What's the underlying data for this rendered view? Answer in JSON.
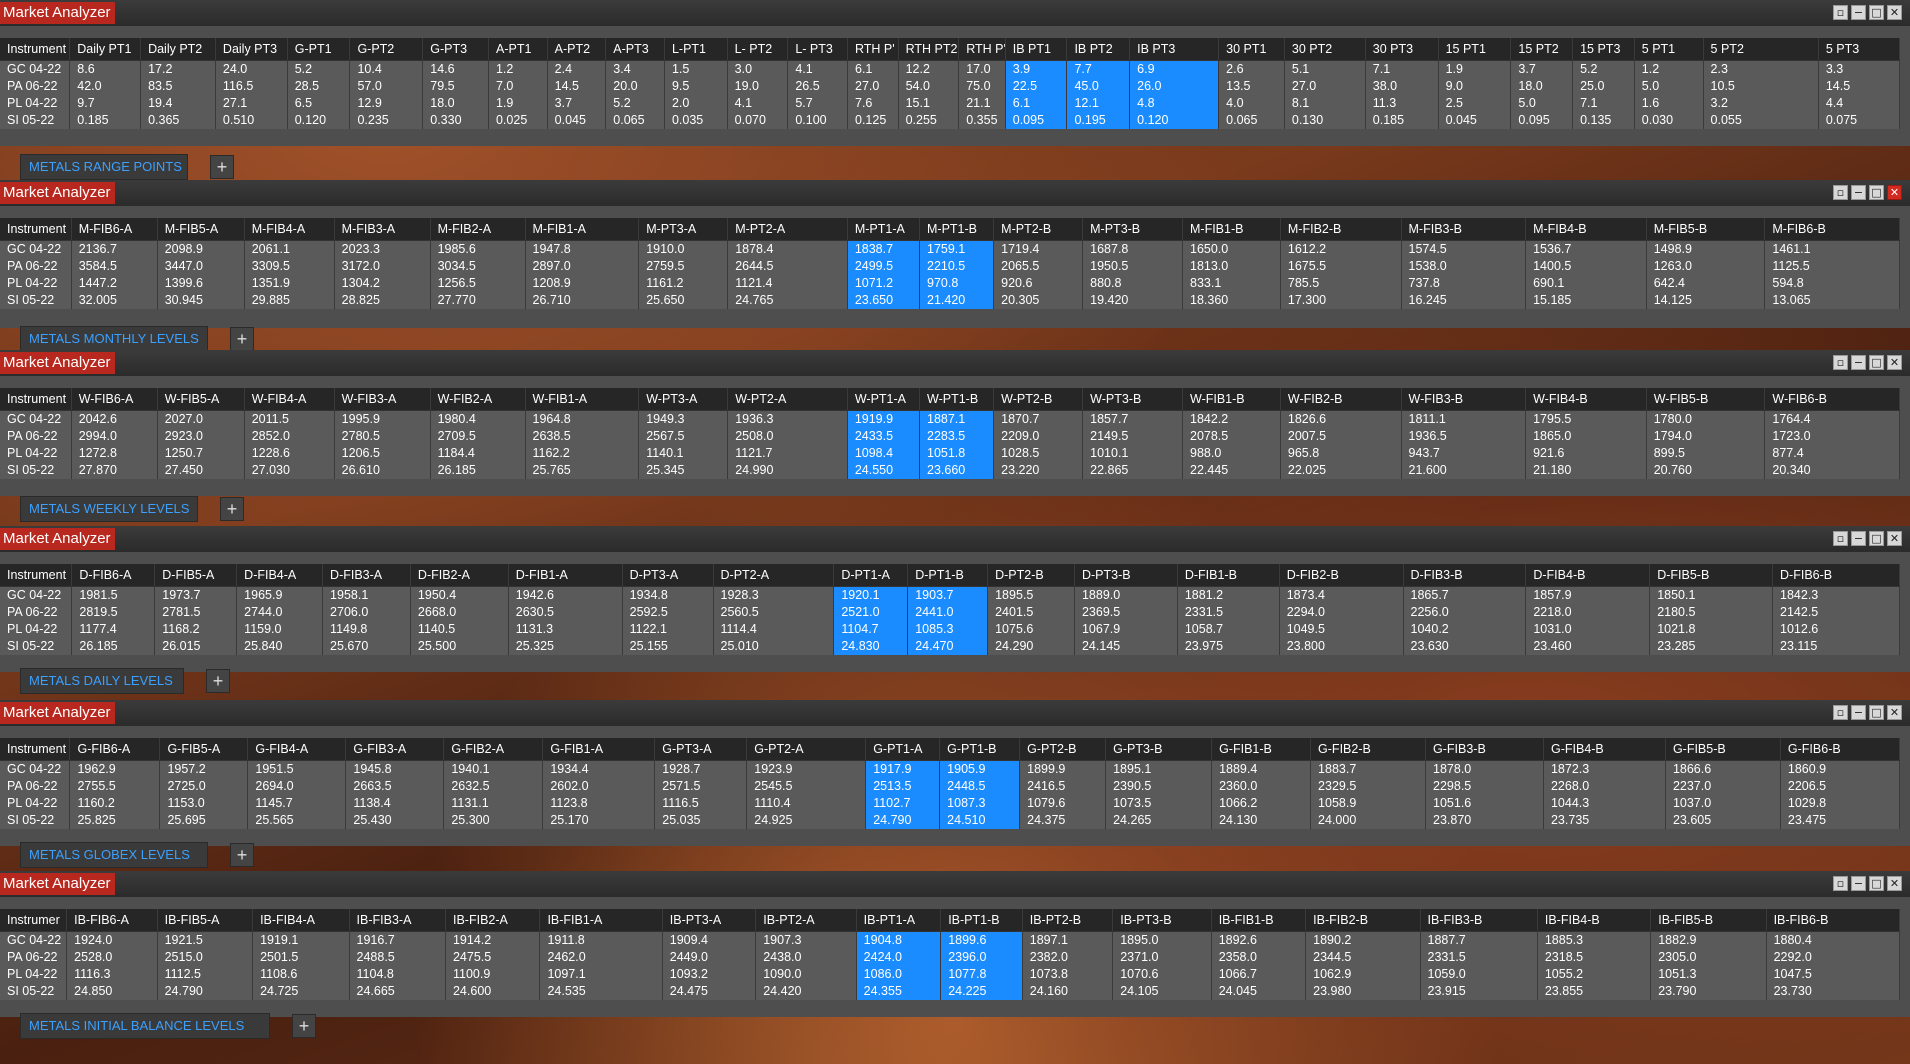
{
  "panels": [
    {
      "title": "Market Analyzer",
      "tab": "METALS RANGE POINTS",
      "close_red": false,
      "columns": [
        "Instrument",
        "Daily PT1",
        "Daily PT2",
        "Daily PT3",
        "G-PT1",
        "G-PT2",
        "G-PT3",
        "A-PT1",
        "A-PT2",
        "A-PT3",
        "L-PT1",
        "L- PT2",
        "L- PT3",
        "RTH P'",
        "RTH PT2",
        "RTH P'",
        "IB PT1",
        "IB PT2",
        "IB PT3",
        "30 PT1",
        "30 PT2",
        "30 PT3",
        "15 PT1",
        "15 PT2",
        "15 PT3",
        "5 PT1",
        "5 PT2",
        "5 PT3"
      ],
      "widths": [
        69,
        70,
        74,
        71,
        62,
        72,
        65,
        58,
        58,
        58,
        62,
        60,
        59,
        50,
        60,
        46,
        61,
        62,
        88,
        65,
        80,
        72,
        72,
        61,
        61,
        68,
        114,
        80
      ],
      "highlight": [
        16,
        17,
        18
      ],
      "rows": [
        [
          "GC 04-22",
          "8.6",
          "17.2",
          "24.0",
          "5.2",
          "10.4",
          "14.6",
          "1.2",
          "2.4",
          "3.4",
          "1.5",
          "3.0",
          "4.1",
          "6.1",
          "12.2",
          "17.0",
          "3.9",
          "7.7",
          "6.9",
          "2.6",
          "5.1",
          "7.1",
          "1.9",
          "3.7",
          "5.2",
          "1.2",
          "2.3",
          "3.3"
        ],
        [
          "PA 06-22",
          "42.0",
          "83.5",
          "116.5",
          "28.5",
          "57.0",
          "79.5",
          "7.0",
          "14.5",
          "20.0",
          "9.5",
          "19.0",
          "26.5",
          "27.0",
          "54.0",
          "75.0",
          "22.5",
          "45.0",
          "26.0",
          "13.5",
          "27.0",
          "38.0",
          "9.0",
          "18.0",
          "25.0",
          "5.0",
          "10.5",
          "14.5"
        ],
        [
          "PL 04-22",
          "9.7",
          "19.4",
          "27.1",
          "6.5",
          "12.9",
          "18.0",
          "1.9",
          "3.7",
          "5.2",
          "2.0",
          "4.1",
          "5.7",
          "7.6",
          "15.1",
          "21.1",
          "6.1",
          "12.1",
          "4.8",
          "4.0",
          "8.1",
          "11.3",
          "2.5",
          "5.0",
          "7.1",
          "1.6",
          "3.2",
          "4.4"
        ],
        [
          "SI 05-22",
          "0.185",
          "0.365",
          "0.510",
          "0.120",
          "0.235",
          "0.330",
          "0.025",
          "0.045",
          "0.065",
          "0.035",
          "0.070",
          "0.100",
          "0.125",
          "0.255",
          "0.355",
          "0.095",
          "0.195",
          "0.120",
          "0.065",
          "0.130",
          "0.185",
          "0.045",
          "0.095",
          "0.135",
          "0.030",
          "0.055",
          "0.075"
        ]
      ]
    },
    {
      "title": "Market Analyzer",
      "tab": "METALS MONTHLY LEVELS",
      "close_red": true,
      "columns": [
        "Instrument",
        "M-FIB6-A",
        "M-FIB5-A",
        "M-FIB4-A",
        "M-FIB3-A",
        "M-FIB2-A",
        "M-FIB1-A",
        "M-PT3-A",
        "M-PT2-A",
        "M-PT1-A",
        "M-PT1-B",
        "M-PT2-B",
        "M-PT3-B",
        "M-FIB1-B",
        "M-FIB2-B",
        "M-FIB3-B",
        "M-FIB4-B",
        "M-FIB5-B",
        "M-FIB6-B"
      ],
      "widths": [
        72,
        87,
        88,
        91,
        97,
        96,
        115,
        90,
        121,
        73,
        75,
        90,
        101,
        99,
        122,
        126,
        122,
        120,
        136
      ],
      "highlight": [
        9,
        10
      ],
      "rows": [
        [
          "GC 04-22",
          "2136.7",
          "2098.9",
          "2061.1",
          "2023.3",
          "1985.6",
          "1947.8",
          "1910.0",
          "1878.4",
          "1838.7",
          "1759.1",
          "1719.4",
          "1687.8",
          "1650.0",
          "1612.2",
          "1574.5",
          "1536.7",
          "1498.9",
          "1461.1"
        ],
        [
          "PA 06-22",
          "3584.5",
          "3447.0",
          "3309.5",
          "3172.0",
          "3034.5",
          "2897.0",
          "2759.5",
          "2644.5",
          "2499.5",
          "2210.5",
          "2065.5",
          "1950.5",
          "1813.0",
          "1675.5",
          "1538.0",
          "1400.5",
          "1263.0",
          "1125.5"
        ],
        [
          "PL 04-22",
          "1447.2",
          "1399.6",
          "1351.9",
          "1304.2",
          "1256.5",
          "1208.9",
          "1161.2",
          "1121.4",
          "1071.2",
          "970.8",
          "920.6",
          "880.8",
          "833.1",
          "785.5",
          "737.8",
          "690.1",
          "642.4",
          "594.8"
        ],
        [
          "SI 05-22",
          "32.005",
          "30.945",
          "29.885",
          "28.825",
          "27.770",
          "26.710",
          "25.650",
          "24.765",
          "23.650",
          "21.420",
          "20.305",
          "19.420",
          "18.360",
          "17.300",
          "16.245",
          "15.185",
          "14.125",
          "13.065"
        ]
      ]
    },
    {
      "title": "Market Analyzer",
      "tab": "METALS WEEKLY LEVELS",
      "close_red": false,
      "columns": [
        "Instrument",
        "W-FIB6-A",
        "W-FIB5-A",
        "W-FIB4-A",
        "W-FIB3-A",
        "W-FIB2-A",
        "W-FIB1-A",
        "W-PT3-A",
        "W-PT2-A",
        "W-PT1-A",
        "W-PT1-B",
        "W-PT2-B",
        "W-PT3-B",
        "W-FIB1-B",
        "W-FIB2-B",
        "W-FIB3-B",
        "W-FIB4-B",
        "W-FIB5-B",
        "W-FIB6-B"
      ],
      "widths": [
        72,
        87,
        88,
        91,
        97,
        96,
        115,
        90,
        121,
        73,
        75,
        90,
        101,
        99,
        122,
        126,
        122,
        120,
        136
      ],
      "highlight": [
        9,
        10
      ],
      "rows": [
        [
          "GC 04-22",
          "2042.6",
          "2027.0",
          "2011.5",
          "1995.9",
          "1980.4",
          "1964.8",
          "1949.3",
          "1936.3",
          "1919.9",
          "1887.1",
          "1870.7",
          "1857.7",
          "1842.2",
          "1826.6",
          "1811.1",
          "1795.5",
          "1780.0",
          "1764.4"
        ],
        [
          "PA 06-22",
          "2994.0",
          "2923.0",
          "2852.0",
          "2780.5",
          "2709.5",
          "2638.5",
          "2567.5",
          "2508.0",
          "2433.5",
          "2283.5",
          "2209.0",
          "2149.5",
          "2078.5",
          "2007.5",
          "1936.5",
          "1865.0",
          "1794.0",
          "1723.0"
        ],
        [
          "PL 04-22",
          "1272.8",
          "1250.7",
          "1228.6",
          "1206.5",
          "1184.4",
          "1162.2",
          "1140.1",
          "1121.7",
          "1098.4",
          "1051.8",
          "1028.5",
          "1010.1",
          "988.0",
          "965.8",
          "943.7",
          "921.6",
          "899.5",
          "877.4"
        ],
        [
          "SI 05-22",
          "27.870",
          "27.450",
          "27.030",
          "26.610",
          "26.185",
          "25.765",
          "25.345",
          "24.990",
          "24.550",
          "23.660",
          "23.220",
          "22.865",
          "22.445",
          "22.025",
          "21.600",
          "21.180",
          "20.760",
          "20.340"
        ]
      ]
    },
    {
      "title": "Market Analyzer",
      "tab": "METALS DAILY LEVELS",
      "close_red": false,
      "columns": [
        "Instrument",
        "D-FIB6-A",
        "D-FIB5-A",
        "D-FIB4-A",
        "D-FIB3-A",
        "D-FIB2-A",
        "D-FIB1-A",
        "D-PT3-A",
        "D-PT2-A",
        "D-PT1-A",
        "D-PT1-B",
        "D-PT2-B",
        "D-PT3-B",
        "D-FIB1-B",
        "D-FIB2-B",
        "D-FIB3-B",
        "D-FIB4-B",
        "D-FIB5-B",
        "D-FIB6-B"
      ],
      "widths": [
        72,
        83,
        82,
        86,
        88,
        98,
        114,
        91,
        121,
        74,
        80,
        87,
        103,
        102,
        124,
        123,
        124,
        123,
        127
      ],
      "highlight": [
        9,
        10
      ],
      "rows": [
        [
          "GC 04-22",
          "1981.5",
          "1973.7",
          "1965.9",
          "1958.1",
          "1950.4",
          "1942.6",
          "1934.8",
          "1928.3",
          "1920.1",
          "1903.7",
          "1895.5",
          "1889.0",
          "1881.2",
          "1873.4",
          "1865.7",
          "1857.9",
          "1850.1",
          "1842.3"
        ],
        [
          "PA 06-22",
          "2819.5",
          "2781.5",
          "2744.0",
          "2706.0",
          "2668.0",
          "2630.5",
          "2592.5",
          "2560.5",
          "2521.0",
          "2441.0",
          "2401.5",
          "2369.5",
          "2331.5",
          "2294.0",
          "2256.0",
          "2218.0",
          "2180.5",
          "2142.5"
        ],
        [
          "PL 04-22",
          "1177.4",
          "1168.2",
          "1159.0",
          "1149.8",
          "1140.5",
          "1131.3",
          "1122.1",
          "1114.4",
          "1104.7",
          "1085.3",
          "1075.6",
          "1067.9",
          "1058.7",
          "1049.5",
          "1040.2",
          "1031.0",
          "1021.8",
          "1012.6"
        ],
        [
          "SI 05-22",
          "26.185",
          "26.015",
          "25.840",
          "25.670",
          "25.500",
          "25.325",
          "25.155",
          "25.010",
          "24.830",
          "24.470",
          "24.290",
          "24.145",
          "23.975",
          "23.800",
          "23.630",
          "23.460",
          "23.285",
          "23.115"
        ]
      ]
    },
    {
      "title": "Market Analyzer",
      "tab": "METALS GLOBEX LEVELS",
      "close_red": false,
      "columns": [
        "Instrument",
        "G-FIB6-A",
        "G-FIB5-A",
        "G-FIB4-A",
        "G-FIB3-A",
        "G-FIB2-A",
        "G-FIB1-A",
        "G-PT3-A",
        "G-PT2-A",
        "G-PT1-A",
        "G-PT1-B",
        "G-PT2-B",
        "G-PT3-B",
        "G-FIB1-B",
        "G-FIB2-B",
        "G-FIB3-B",
        "G-FIB4-B",
        "G-FIB5-B",
        "G-FIB6-B"
      ],
      "widths": [
        70,
        90,
        88,
        98,
        98,
        99,
        112,
        92,
        119,
        74,
        80,
        86,
        106,
        99,
        115,
        118,
        122,
        115,
        119
      ],
      "highlight": [
        9,
        10
      ],
      "rows": [
        [
          "GC 04-22",
          "1962.9",
          "1957.2",
          "1951.5",
          "1945.8",
          "1940.1",
          "1934.4",
          "1928.7",
          "1923.9",
          "1917.9",
          "1905.9",
          "1899.9",
          "1895.1",
          "1889.4",
          "1883.7",
          "1878.0",
          "1872.3",
          "1866.6",
          "1860.9"
        ],
        [
          "PA 06-22",
          "2755.5",
          "2725.0",
          "2694.0",
          "2663.5",
          "2632.5",
          "2602.0",
          "2571.5",
          "2545.5",
          "2513.5",
          "2448.5",
          "2416.5",
          "2390.5",
          "2360.0",
          "2329.5",
          "2298.5",
          "2268.0",
          "2237.0",
          "2206.5"
        ],
        [
          "PL 04-22",
          "1160.2",
          "1153.0",
          "1145.7",
          "1138.4",
          "1131.1",
          "1123.8",
          "1116.5",
          "1110.4",
          "1102.7",
          "1087.3",
          "1079.6",
          "1073.5",
          "1066.2",
          "1058.9",
          "1051.6",
          "1044.3",
          "1037.0",
          "1029.8"
        ],
        [
          "SI 05-22",
          "25.825",
          "25.695",
          "25.565",
          "25.430",
          "25.300",
          "25.170",
          "25.035",
          "24.925",
          "24.790",
          "24.510",
          "24.375",
          "24.265",
          "24.130",
          "24.000",
          "23.870",
          "23.735",
          "23.605",
          "23.475"
        ]
      ]
    },
    {
      "title": "Market Analyzer",
      "tab": "METALS  INITIAL BALANCE LEVELS",
      "close_red": false,
      "columns": [
        "Instrumer",
        "IB-FIB6-A",
        "IB-FIB5-A",
        "IB-FIB4-A",
        "IB-FIB3-A",
        "IB-FIB2-A",
        "IB-FIB1-A",
        "IB-PT3-A",
        "IB-PT2-A",
        "IB-PT1-A",
        "IB-PT1-B",
        "IB-PT2-B",
        "IB-PT3-B",
        "IB-FIB1-B",
        "IB-FIB2-B",
        "IB-FIB3-B",
        "IB-FIB4-B",
        "IB-FIB5-B",
        "IB-FIB6-B"
      ],
      "widths": [
        67,
        91,
        96,
        97,
        97,
        95,
        123,
        94,
        101,
        85,
        82,
        91,
        99,
        95,
        115,
        118,
        114,
        116,
        134
      ],
      "highlight": [
        9,
        10
      ],
      "rows": [
        [
          "GC 04-22",
          "1924.0",
          "1921.5",
          "1919.1",
          "1916.7",
          "1914.2",
          "1911.8",
          "1909.4",
          "1907.3",
          "1904.8",
          "1899.6",
          "1897.1",
          "1895.0",
          "1892.6",
          "1890.2",
          "1887.7",
          "1885.3",
          "1882.9",
          "1880.4"
        ],
        [
          "PA 06-22",
          "2528.0",
          "2515.0",
          "2501.5",
          "2488.5",
          "2475.5",
          "2462.0",
          "2449.0",
          "2438.0",
          "2424.0",
          "2396.0",
          "2382.0",
          "2371.0",
          "2358.0",
          "2344.5",
          "2331.5",
          "2318.5",
          "2305.0",
          "2292.0"
        ],
        [
          "PL 04-22",
          "1116.3",
          "1112.5",
          "1108.6",
          "1104.8",
          "1100.9",
          "1097.1",
          "1093.2",
          "1090.0",
          "1086.0",
          "1077.8",
          "1073.8",
          "1070.6",
          "1066.7",
          "1062.9",
          "1059.0",
          "1055.2",
          "1051.3",
          "1047.5"
        ],
        [
          "SI 05-22",
          "24.850",
          "24.790",
          "24.725",
          "24.665",
          "24.600",
          "24.535",
          "24.475",
          "24.420",
          "24.355",
          "24.225",
          "24.160",
          "24.105",
          "24.045",
          "23.980",
          "23.915",
          "23.855",
          "23.790",
          "23.730"
        ]
      ]
    }
  ],
  "window_buttons": {
    "restore": "▫",
    "minimize": "−",
    "maximize": "□",
    "close": "✕"
  },
  "tab_add_label": "+",
  "colors": {
    "title_bg": "#b8281f",
    "highlight": "#1a8cff",
    "tab_text": "#3ca0ff"
  }
}
